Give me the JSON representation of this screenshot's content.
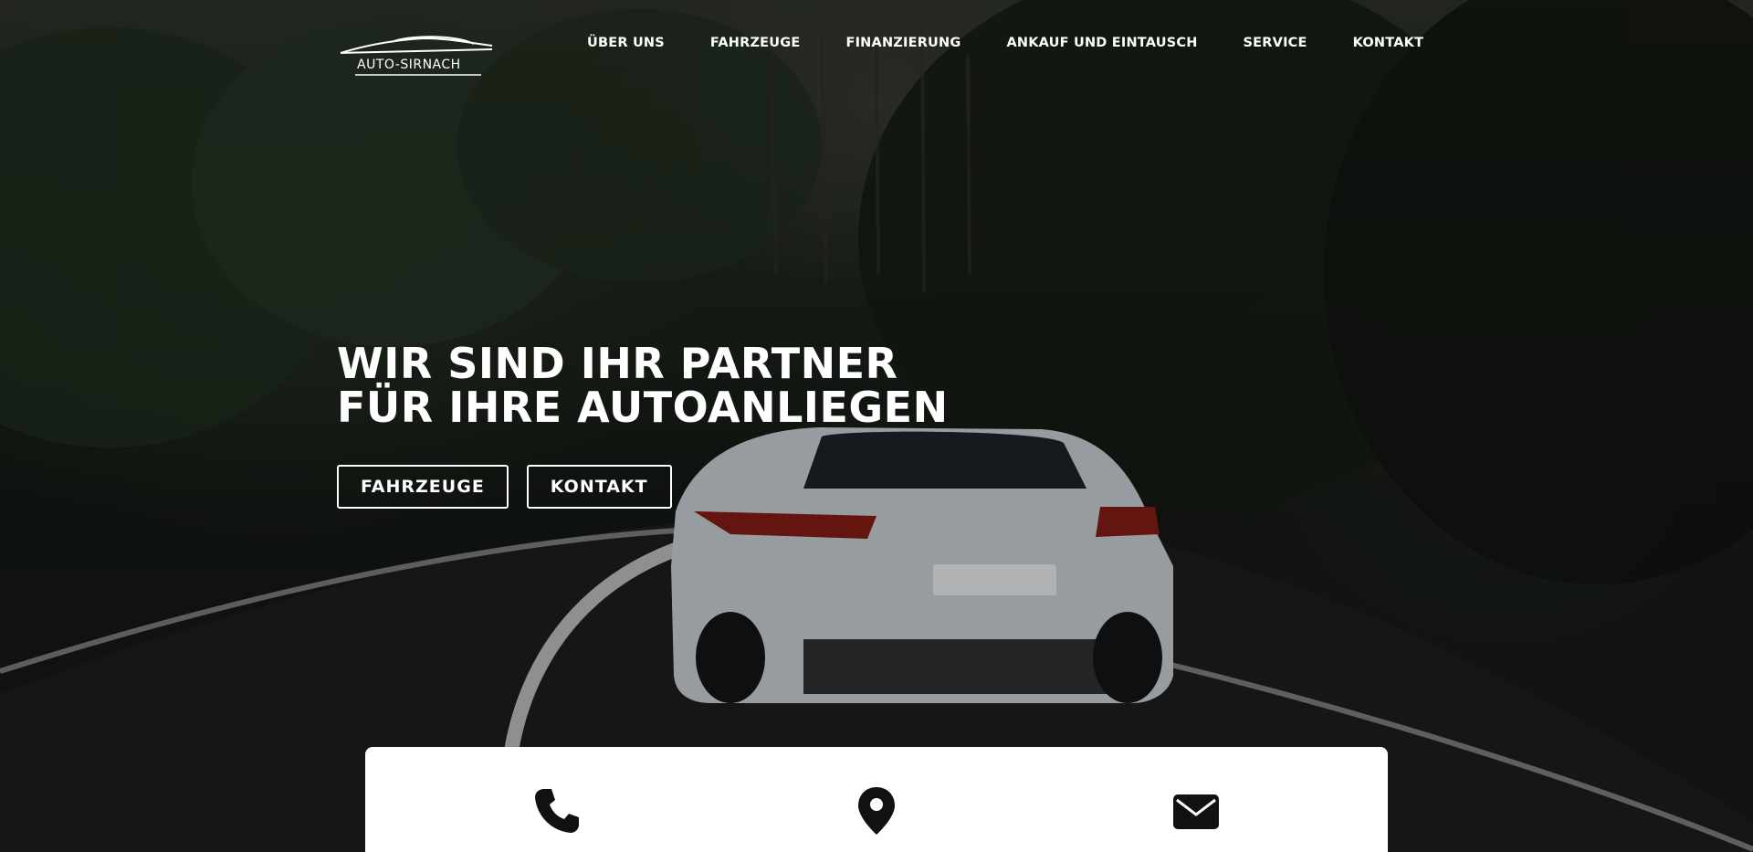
{
  "brand": {
    "logo_text": "AUTO-SIRNACH",
    "logo_icon": "car-silhouette-icon"
  },
  "nav": {
    "items": [
      {
        "label": "ÜBER UNS"
      },
      {
        "label": "FAHRZEUGE"
      },
      {
        "label": "FINANZIERUNG"
      },
      {
        "label": "ANKAUF UND EINTAUSCH"
      },
      {
        "label": "SERVICE"
      },
      {
        "label": "KONTAKT"
      }
    ]
  },
  "hero": {
    "headline_line1": "WIR SIND IHR PARTNER",
    "headline_line2": "FÜR IHRE AUTOANLIEGEN",
    "buttons": [
      {
        "label": "FAHRZEUGE"
      },
      {
        "label": "KONTAKT"
      }
    ],
    "background": "car-on-forest-road-image"
  },
  "contact_bar": {
    "icons": [
      "phone-icon",
      "map-pin-icon",
      "envelope-icon"
    ]
  },
  "colors": {
    "text": "#ffffff",
    "card": "#ffffff",
    "icon": "#111111"
  }
}
